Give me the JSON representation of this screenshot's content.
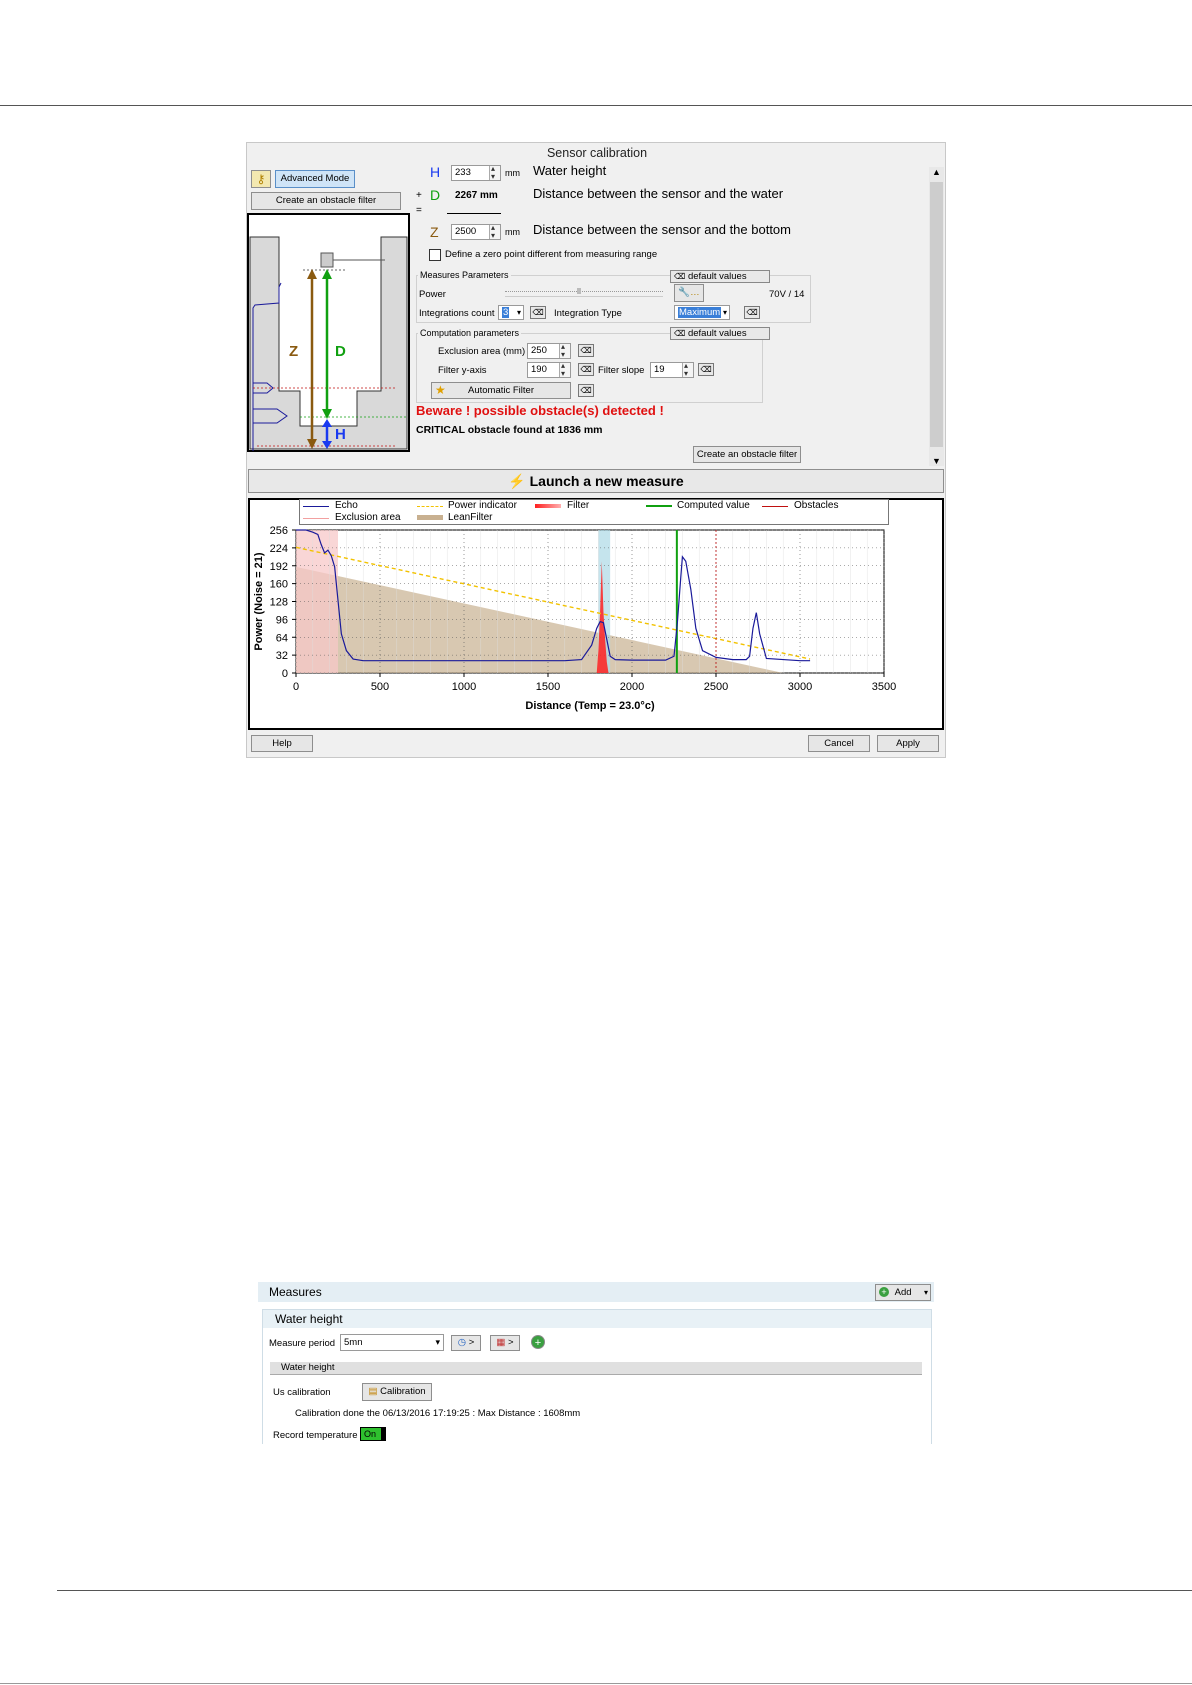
{
  "dialog": {
    "title": "Sensor calibration",
    "advanced_mode": "Advanced Mode",
    "create_filter_top": "Create an obstacle filter",
    "diagram": {
      "z": "Z",
      "d": "D",
      "h": "H"
    },
    "h_letter": "H",
    "h_value": "233",
    "h_unit": "mm",
    "h_desc": "Water height",
    "plus": "+",
    "d_letter": "D",
    "d_value": "2267 mm",
    "d_desc": "Distance between the sensor and the water",
    "equals": "=",
    "z_letter": "Z",
    "z_value": "2500",
    "z_unit": "mm",
    "z_desc": "Distance between the sensor and the bottom",
    "zero_point_label": "Define a zero point different from measuring range",
    "measures_params": {
      "title": "Measures Parameters",
      "default_values": "default values",
      "power_label": "Power",
      "power_value": "70V / 14",
      "integrations_label": "Integrations count",
      "integrations_value": "3",
      "integration_type_label": "Integration Type",
      "integration_type_value": "Maximum"
    },
    "computation_params": {
      "title": "Computation parameters",
      "default_values": "default values",
      "exclusion_label": "Exclusion area (mm)",
      "exclusion_value": "250",
      "filter_y_label": "Filter y-axis",
      "filter_y_value": "190",
      "filter_slope_label": "Filter slope",
      "filter_slope_value": "19",
      "auto_filter": "Automatic Filter"
    },
    "warning": "Beware ! possible obstacle(s) detected !",
    "critical": "CRITICAL obstacle found at 1836 mm",
    "create_filter_bottom": "Create an obstacle filter",
    "launch": "Launch a new measure",
    "help": "Help",
    "cancel": "Cancel",
    "apply": "Apply"
  },
  "chart_data": {
    "type": "line",
    "xlabel": "Distance (Temp = 23.0°c)",
    "ylabel": "Power (Noise = 21)",
    "xlim": [
      0,
      3500
    ],
    "ylim": [
      0,
      256
    ],
    "xticks": [
      0,
      500,
      1000,
      1500,
      2000,
      2500,
      3000,
      3500
    ],
    "yticks": [
      0,
      32,
      64,
      96,
      128,
      160,
      192,
      224,
      256
    ],
    "grid": true,
    "legend": [
      "Echo",
      "Power indicator",
      "Filter",
      "Computed value",
      "Obstacles",
      "Exclusion area",
      "LeanFilter"
    ],
    "colors": {
      "echo": "#1a1a9a",
      "power": "#f2c200",
      "filter": "#ff2020",
      "computed": "#10a010",
      "obstacles": "#c01010",
      "exclusion": "#f7c8c8",
      "lean": "#c8b090"
    },
    "echo": {
      "x": [
        0,
        60,
        100,
        130,
        150,
        170,
        190,
        210,
        230,
        250,
        270,
        300,
        340,
        400,
        600,
        800,
        1000,
        1200,
        1400,
        1600,
        1700,
        1760,
        1790,
        1810,
        1830,
        1850,
        1870,
        1900,
        2000,
        2200,
        2250,
        2270,
        2290,
        2300,
        2320,
        2350,
        2380,
        2420,
        2500,
        2600,
        2680,
        2700,
        2720,
        2740,
        2760,
        2800,
        3000,
        3060
      ],
      "y": [
        256,
        256,
        252,
        248,
        230,
        215,
        220,
        210,
        190,
        130,
        70,
        40,
        25,
        22,
        22,
        22,
        22,
        22,
        22,
        22,
        24,
        50,
        80,
        92,
        90,
        60,
        30,
        24,
        23,
        23,
        30,
        90,
        170,
        208,
        200,
        150,
        80,
        40,
        28,
        24,
        24,
        30,
        80,
        108,
        70,
        26,
        22,
        22
      ]
    },
    "power_indicator": {
      "x": [
        0,
        3060
      ],
      "y": [
        225,
        25
      ]
    },
    "lean_filter": {
      "x": [
        0,
        2900
      ],
      "y": [
        190,
        0
      ]
    },
    "exclusion_area": [
      0,
      250
    ],
    "filter_band": [
      1800,
      1870
    ],
    "filter_peak": {
      "x": [
        1790,
        1800,
        1810,
        1820,
        1830,
        1840,
        1850,
        1860
      ],
      "y": [
        0,
        40,
        110,
        200,
        110,
        60,
        20,
        0
      ]
    },
    "computed_value": 2267,
    "obstacle_line": 2500
  },
  "measures": {
    "title": "Measures",
    "add": "Add",
    "water_height": "Water height",
    "period_label": "Measure period",
    "period_value": "5mn",
    "arrow": ">",
    "section": "Water height",
    "us_calibration": "Us calibration",
    "calibration_btn": "Calibration",
    "calibration_done": "Calibration done the 06/13/2016 17:19:25 : Max Distance : 1608mm",
    "record_temp": "Record temperature",
    "toggle": "On"
  }
}
